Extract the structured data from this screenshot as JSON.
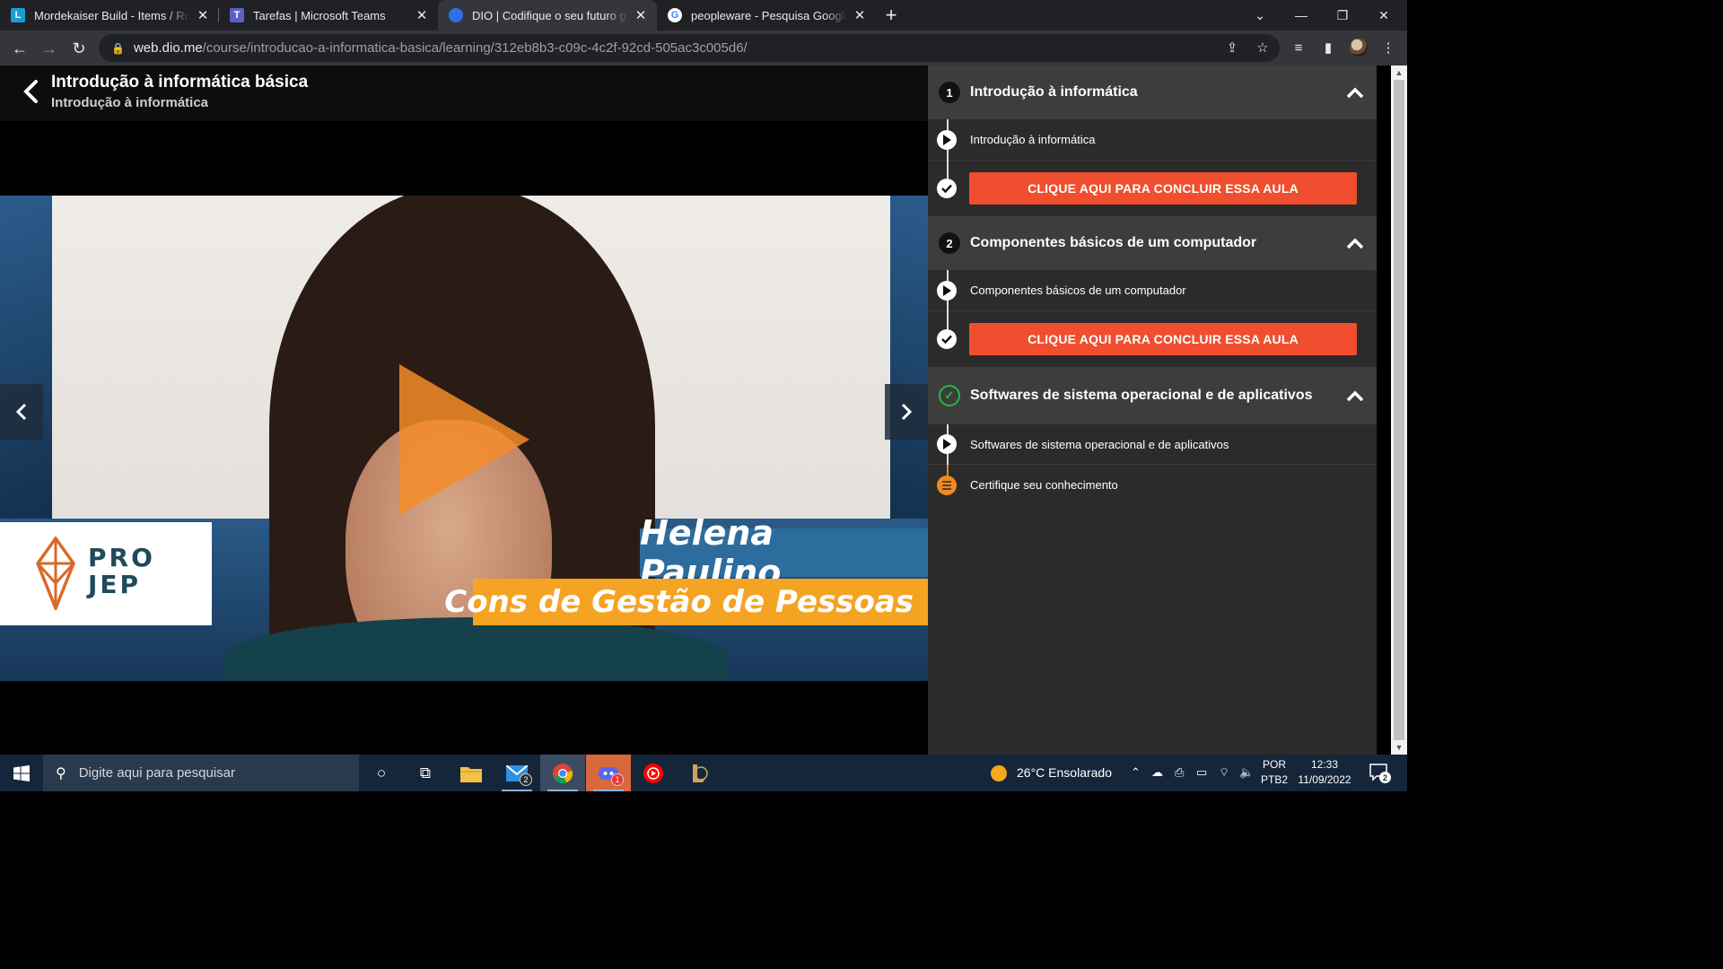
{
  "browser": {
    "tabs": [
      {
        "title": "Mordekaiser Build - Items / Rune",
        "favicon": "L",
        "favicon_color": "#1d9bd7",
        "active": false
      },
      {
        "title": "Tarefas | Microsoft Teams",
        "favicon": "T",
        "favicon_color": "#5b5fc7",
        "active": false
      },
      {
        "title": "DIO | Codifique o seu futuro glob",
        "favicon": "D",
        "favicon_color": "#2f6fe8",
        "active": true
      },
      {
        "title": "peopleware - Pesquisa Google",
        "favicon": "G",
        "favicon_color": "#ffffff",
        "active": false
      }
    ],
    "url_host": "web.dio.me",
    "url_path": "/course/introducao-a-informatica-basica/learning/312eb8b3-c09c-4c2f-92cd-505ac3c005d6/"
  },
  "course": {
    "title": "Introdução à informática básica",
    "subtitle": "Introdução à informática"
  },
  "video": {
    "logo_line1": "PRO",
    "logo_line2": "JEP",
    "presenter_name": "Helena Paulino",
    "presenter_role": "Cons de Gestão de Pessoas",
    "accent_orange": "#f5a323",
    "accent_blue": "#2d6d9e"
  },
  "sidebar": {
    "sections": [
      {
        "number": "1",
        "title": "Introdução à informática",
        "completed": false,
        "lesson": "Introdução à informática",
        "cta": "CLIQUE AQUI PARA CONCLUIR ESSA AULA"
      },
      {
        "number": "2",
        "title": "Componentes básicos de um computador",
        "completed": false,
        "lesson": "Componentes básicos de um computador",
        "cta": "CLIQUE AQUI PARA CONCLUIR ESSA AULA"
      },
      {
        "number": "",
        "title": "Softwares de sistema operacional e de aplicativos",
        "completed": true,
        "lesson": "Softwares de sistema operacional e de aplicativos",
        "quiz": "Certifique seu conhecimento"
      }
    ],
    "cta_color": "#f04e2e"
  },
  "taskbar": {
    "search_placeholder": "Digite aqui para pesquisar",
    "mail_badge": "2",
    "discord_badge": "1",
    "weather": "26°C  Ensolarado",
    "lang_top": "POR",
    "lang_bottom": "PTB2",
    "time": "12:33",
    "date": "11/09/2022",
    "notif_count": "2"
  }
}
